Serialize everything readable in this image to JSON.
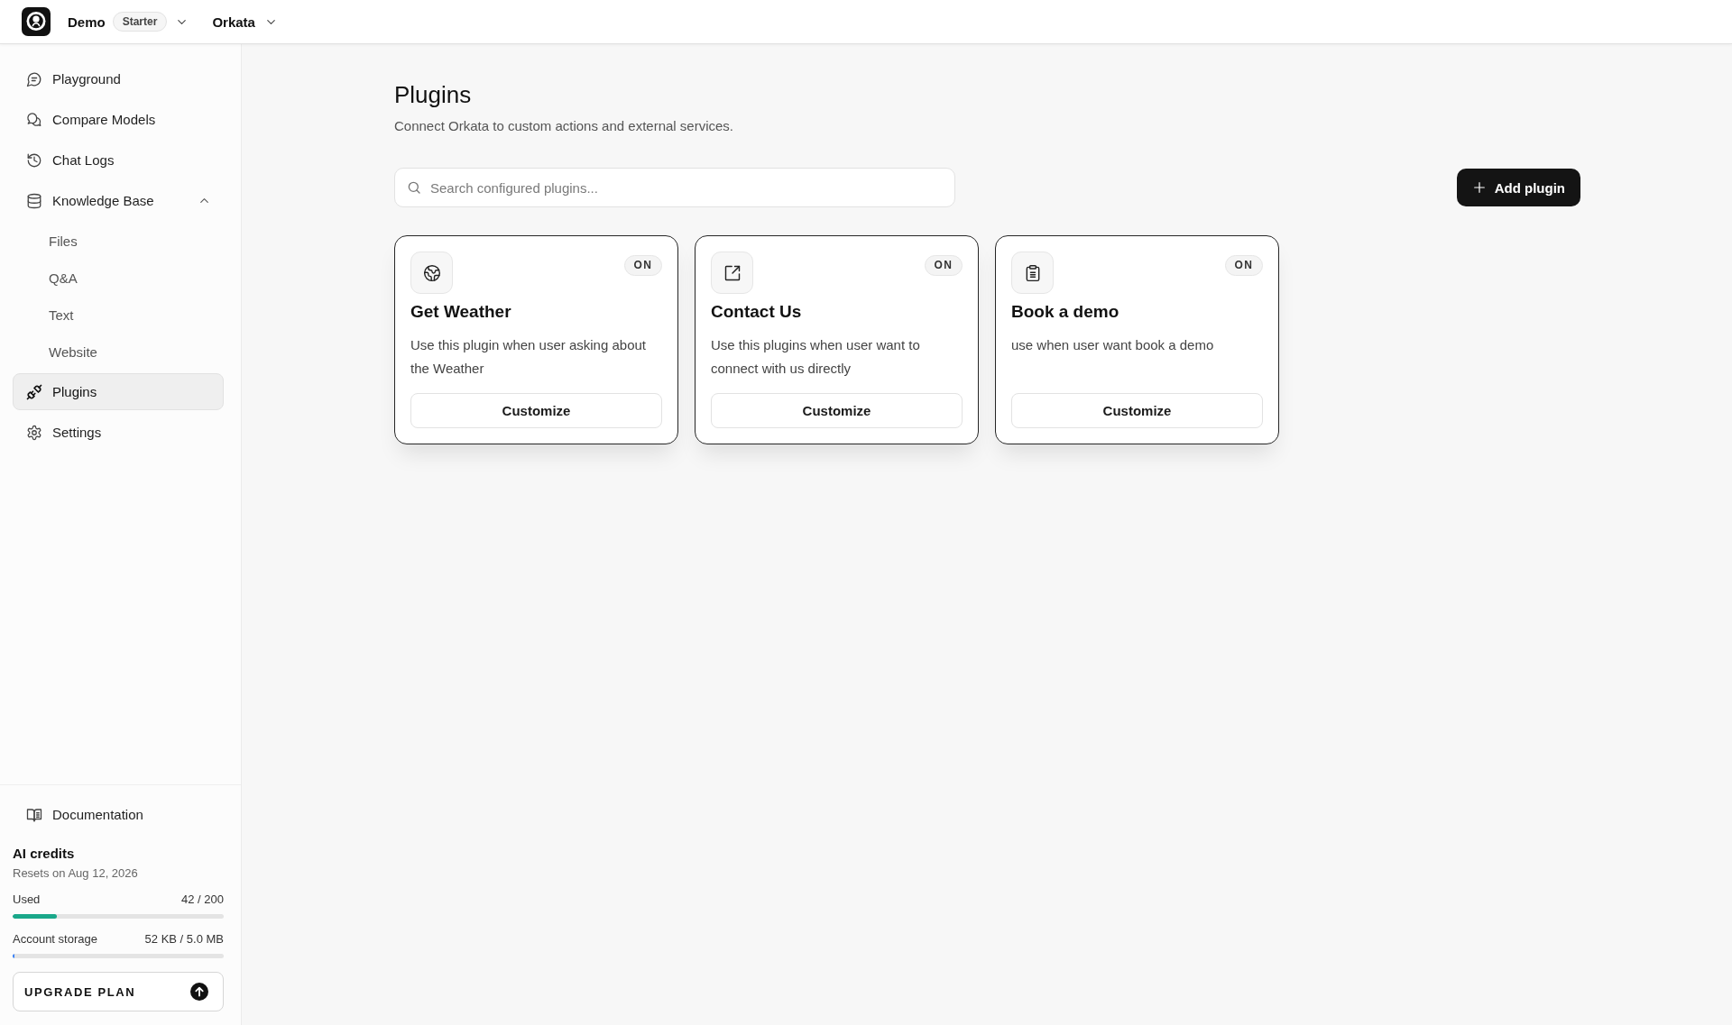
{
  "top_bar": {
    "workspace": "Demo",
    "plan_badge": "Starter",
    "project": "Orkata"
  },
  "sidebar": {
    "items": [
      {
        "label": "Playground",
        "selected": false
      },
      {
        "label": "Compare Models",
        "selected": false
      },
      {
        "label": "Chat Logs",
        "selected": false
      },
      {
        "label": "Knowledge Base",
        "selected": false,
        "expanded": true,
        "children": [
          {
            "label": "Files",
            "selected": false
          },
          {
            "label": "Q&A",
            "selected": false
          },
          {
            "label": "Text",
            "selected": false
          },
          {
            "label": "Website",
            "selected": false
          }
        ]
      },
      {
        "label": "Plugins",
        "selected": true
      },
      {
        "label": "Settings",
        "selected": false
      }
    ],
    "documentation_link": "Documentation",
    "credits": {
      "title": "AI credits",
      "reset_note": "Resets on Aug 12, 2026",
      "meters": [
        {
          "label": "Used",
          "reading": "42 / 200",
          "level": 0.21,
          "color": "#1aa88a"
        },
        {
          "label": "Account storage",
          "reading": "52 KB / 5.0 MB",
          "level": 0.01,
          "color": "#3b82f6"
        }
      ]
    },
    "upgrade_button": "UPGRADE PLAN"
  },
  "main": {
    "title": "Plugins",
    "subtitle": "Connect Orkata to custom actions and external services.",
    "search": {
      "placeholder": "Search configured plugins..."
    },
    "add_button": "Add plugin",
    "plugins": [
      {
        "name": "Get Weather",
        "description": "Use this plugin when user asking about the Weather",
        "status": "ON",
        "action": "Customize"
      },
      {
        "name": "Contact Us",
        "description": "Use this plugins when user want to connect with us directly",
        "status": "ON",
        "action": "Customize"
      },
      {
        "name": "Book a demo",
        "description": "use when user want book a demo",
        "status": "ON",
        "action": "Customize"
      }
    ]
  }
}
